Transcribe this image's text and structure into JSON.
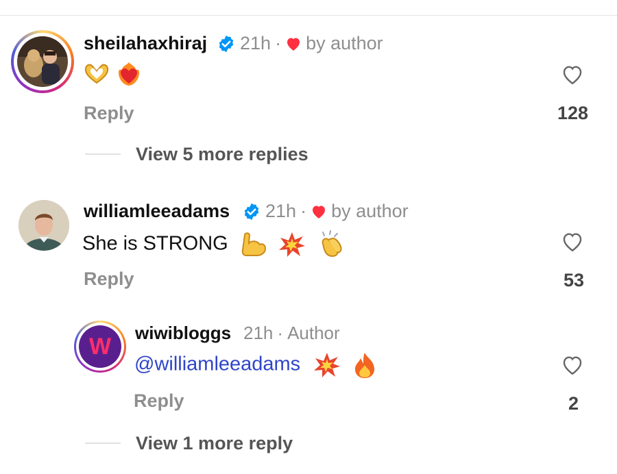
{
  "comments": [
    {
      "username": "sheilahaxhiraj",
      "time": "21h",
      "separator": "·",
      "liked_by": "by author",
      "text": "",
      "emojis": [
        "heart-hands-emoji",
        "heart-on-fire-emoji"
      ],
      "reply_label": "Reply",
      "like_count": "128",
      "view_more": "View 5 more replies"
    },
    {
      "username": "williamleeadams",
      "time": "21h",
      "separator": "·",
      "liked_by": "by author",
      "text": "She is STRONG",
      "emojis": [
        "flexed-biceps-emoji",
        "collision-emoji",
        "clapping-hands-emoji"
      ],
      "reply_label": "Reply",
      "like_count": "53"
    }
  ],
  "reply": {
    "username": "wiwibloggs",
    "time": "21h",
    "separator": "·",
    "author_label": "Author",
    "avatar_letter": "W",
    "mention": "@williamleeadams",
    "emojis": [
      "collision-emoji",
      "fire-emoji"
    ],
    "reply_label": "Reply",
    "like_count": "2",
    "view_more": "View 1 more reply"
  },
  "colors": {
    "verified": "#0095f6",
    "heart": "#ff3040",
    "mention": "#2f45c8",
    "muted": "#8e8e8e"
  }
}
